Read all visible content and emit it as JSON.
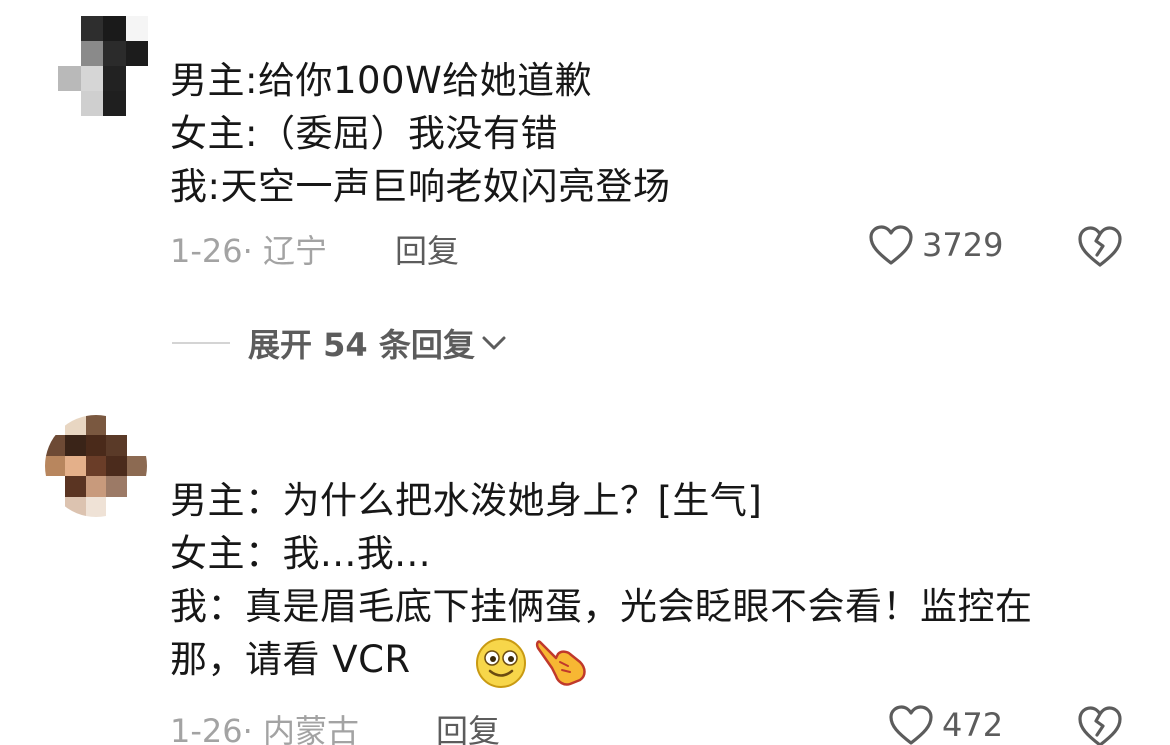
{
  "comments": [
    {
      "avatar": {
        "icon": "pixelated-avatar",
        "pixels": [
          "#ffffff",
          "#2e2e2e",
          "#1a1a1a",
          "#f5f5f5",
          "#ffffff",
          "#8a8a8a",
          "#2b2b2b",
          "#1c1c1c",
          "#b9b9b9",
          "#d6d6d6",
          "#222222",
          "#ffffff",
          "#ffffff",
          "#cfcfcf",
          "#1f1f1f",
          "#ffffff"
        ]
      },
      "lines": [
        "男主:给你100W给她道歉",
        "女主:（委屈）我没有错",
        "我:天空一声巨响老奴闪亮登场"
      ],
      "date_location": "1-26· 辽宁",
      "reply_label": "回复",
      "likes": "3729"
    },
    {
      "avatar": {
        "icon": "pixelated-avatar",
        "pixels": [
          "#ffffff",
          "#e8d6c2",
          "#7a5840",
          "#ffffff",
          "#ffffff",
          "#6d4a35",
          "#3a2418",
          "#4a2a1a",
          "#5a3a28",
          "#ffffff",
          "#b8865e",
          "#e4b08a",
          "#6a3d28",
          "#4b2b1c",
          "#8c6a52",
          "#ffffff",
          "#5a3422",
          "#c89a7c",
          "#9c7a66",
          "#ffffff",
          "#ffffff",
          "#dcc3b0",
          "#efe2d6",
          "#ffffff",
          "#ffffff"
        ]
      },
      "lines": [
        "男主：为什么把水泼她身上？[生气]",
        "女主：我...我...",
        "我：真是眉毛底下挂俩蛋，光会眨眼不会看！监控在那，请看 VCR"
      ],
      "date_location": "1-26· 内蒙古",
      "reply_label": "回复",
      "likes": "472",
      "emojis": [
        "smile-emoji",
        "pointing-hand-emoji"
      ]
    }
  ],
  "expand_replies": {
    "label": "展开 54 条回复",
    "icon": "chevron-down-icon"
  },
  "icons": {
    "like": "heart-outline-icon",
    "dislike": "broken-heart-icon"
  },
  "colors": {
    "text_primary": "#171717",
    "text_meta": "#a3a3a3",
    "text_secondary": "#5c5c5c"
  }
}
